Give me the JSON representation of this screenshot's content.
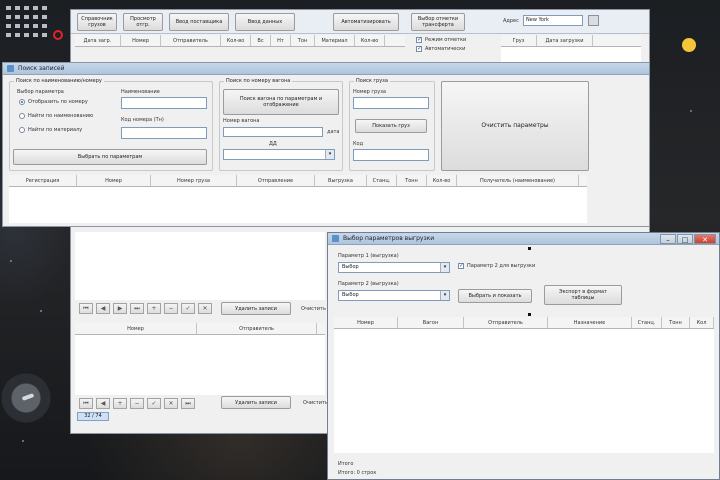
{
  "back_window": {
    "toolbar_buttons": [
      "Справочник грузов",
      "Просмотр отгр.",
      "Ввод поставщика",
      "Ввод данных",
      "Автоматизировать",
      "Выбор отметки трансферта"
    ],
    "search_label": "Адрес",
    "search_value": "New York",
    "mode_check_label": "Режим отметки",
    "auto_check_label": "Автоматически",
    "top_columns": [
      "Дата загр.",
      "Номер",
      "Отправитель",
      "Кол-во",
      "Вс",
      "Нт",
      "Тон",
      "Материал",
      "Кол-во"
    ],
    "right_columns": [
      "Груз",
      "Дата загрузки"
    ],
    "mid_action": "Удалить записи",
    "mid_side": "Очистить",
    "bottom_columns": [
      "Номер",
      "Отправитель"
    ],
    "bottom_action": "Удалить записи",
    "bottom_side": "Очистить",
    "status_tag": "32 / 74"
  },
  "main_window": {
    "title": "Поиск записей",
    "group_left_title": "Поиск по наименованию/номеру",
    "radio_caption": "Выбор параметра",
    "radio_options": [
      "Отобразить по номеру",
      "Найти по наименованию",
      "Найти по материалу"
    ],
    "field_name_label": "Наименование",
    "field_code_label": "Код номера (Тн)",
    "search_button": "Выбрать по параметрам",
    "group_mid_title": "Поиск по номеру вагона",
    "mid_button": "Поиск вагона по параметрам и отображение",
    "mid_label": "Номер вагона",
    "mid_small_label": "дата",
    "mid_combo_label": "ДД",
    "group_right_title": "Поиск груза",
    "right_field_label": "Номер груза",
    "right_button": "Показать груз",
    "right_field2_label": "Код",
    "big_button": "Очистить параметры",
    "grid_columns": [
      "Регистрация",
      "Номер",
      "Номер груза",
      "Отправление",
      "Выгрузка",
      "Станц.",
      "Тонн",
      "Кол-во",
      "Получатель (наименование)"
    ]
  },
  "popup_window": {
    "title": "Выбор параметров выгрузки",
    "combo1_label": "Параметр 1 (выгрузка)",
    "combo1_value": "Выбор",
    "combo2_label": "Параметр 2 (выгрузка)",
    "combo2_value": "Выбор",
    "check_label": "Параметр 2 для выгрузки",
    "apply_button": "Выбрать и показать",
    "export_button": "Экспорт в формат таблицы",
    "grid_columns": [
      "Номер",
      "Вагон",
      "Отправитель",
      "Назначение",
      "Станц.",
      "Тонн",
      "Кол"
    ],
    "footer_label": "Итого",
    "footer_value": "Итого: 0 строк"
  }
}
